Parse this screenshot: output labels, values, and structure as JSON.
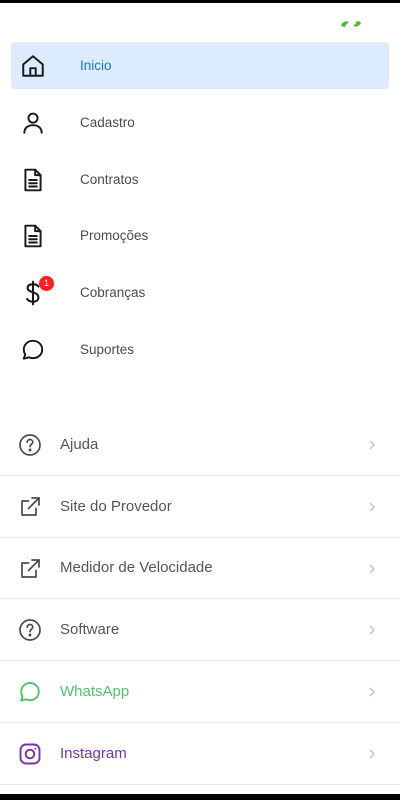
{
  "nav": {
    "items": [
      {
        "label": "Inicio",
        "icon": "home-icon",
        "active": true
      },
      {
        "label": "Cadastro",
        "icon": "user-icon"
      },
      {
        "label": "Contratos",
        "icon": "document-icon"
      },
      {
        "label": "Promoções",
        "icon": "document-icon"
      },
      {
        "label": "Cobranças",
        "icon": "dollar-icon",
        "badge": "1"
      },
      {
        "label": "Suportes",
        "icon": "chat-icon"
      }
    ]
  },
  "links": [
    {
      "label": "Ajuda",
      "icon": "help-icon"
    },
    {
      "label": "Site do Provedor",
      "icon": "external-link-icon"
    },
    {
      "label": "Medidor de Velocidade",
      "icon": "external-link-icon"
    },
    {
      "label": "Software",
      "icon": "help-icon"
    },
    {
      "label": "WhatsApp",
      "icon": "whatsapp-icon"
    },
    {
      "label": "Instagram",
      "icon": "instagram-icon"
    }
  ],
  "colors": {
    "accent": "#1976d2",
    "active_bg": "#dcebfd",
    "badge": "#ff1f1f",
    "whatsapp": "#4fc36b",
    "instagram": "#7b2fa8",
    "logo": "#4cbb2c"
  }
}
